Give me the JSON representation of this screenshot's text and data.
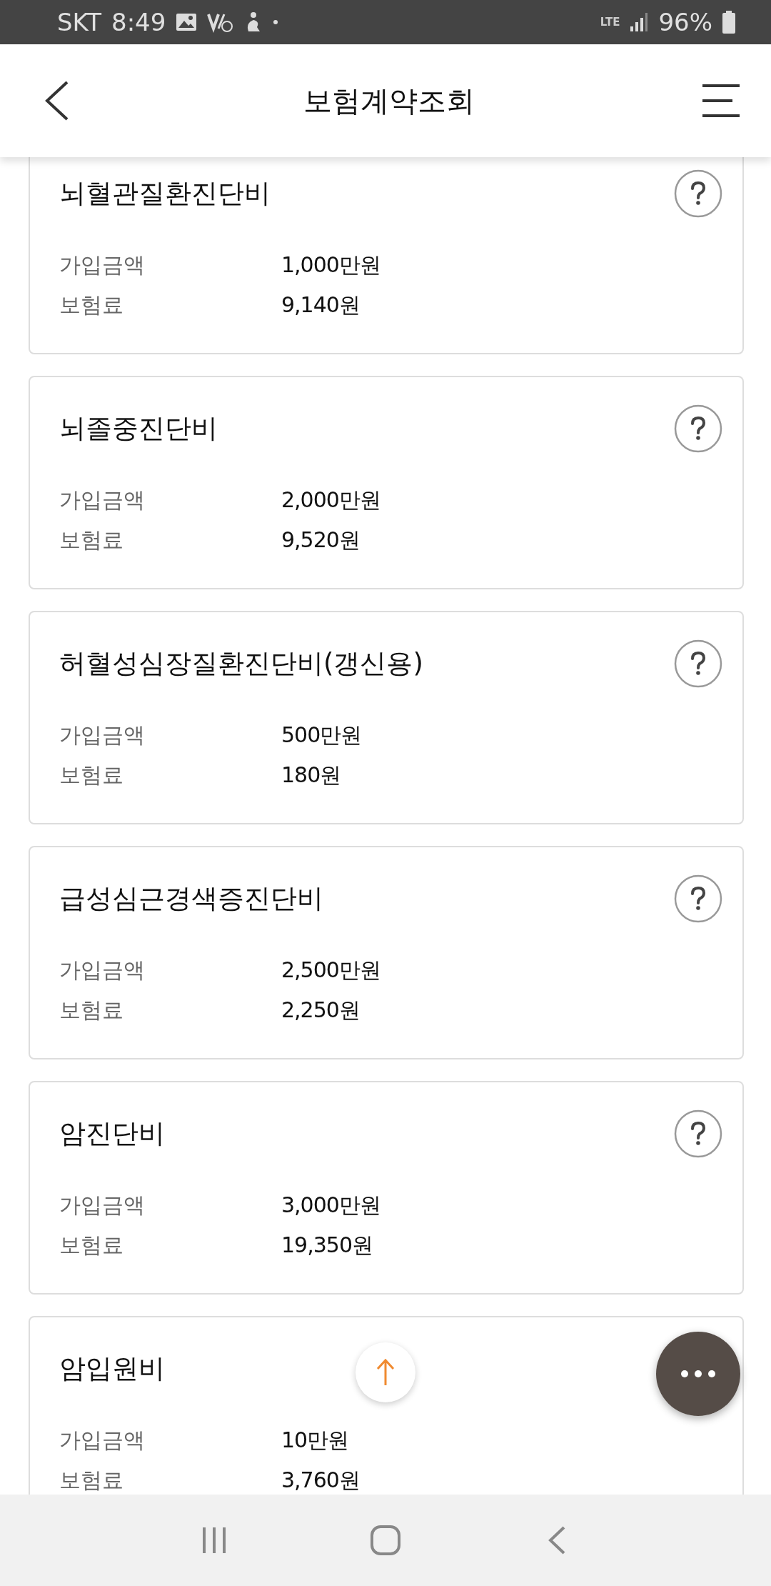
{
  "status_bar": {
    "carrier": "SKT",
    "time": "8:49",
    "network": "LTE",
    "battery": "96%"
  },
  "header": {
    "title": "보험계약조회"
  },
  "coverages": [
    {
      "name": "뇌혈관질환진단비",
      "help": true,
      "rows": [
        {
          "label": "가입금액",
          "value": "1,000만원"
        },
        {
          "label": "보험료",
          "value": "9,140원"
        }
      ]
    },
    {
      "name": "뇌졸중진단비",
      "help": true,
      "rows": [
        {
          "label": "가입금액",
          "value": "2,000만원"
        },
        {
          "label": "보험료",
          "value": "9,520원"
        }
      ]
    },
    {
      "name": "허혈성심장질환진단비(갱신용)",
      "help": true,
      "rows": [
        {
          "label": "가입금액",
          "value": "500만원"
        },
        {
          "label": "보험료",
          "value": "180원"
        }
      ]
    },
    {
      "name": "급성심근경색증진단비",
      "help": true,
      "rows": [
        {
          "label": "가입금액",
          "value": "2,500만원"
        },
        {
          "label": "보험료",
          "value": "2,250원"
        }
      ]
    },
    {
      "name": "암진단비",
      "help": true,
      "rows": [
        {
          "label": "가입금액",
          "value": "3,000만원"
        },
        {
          "label": "보험료",
          "value": "19,350원"
        }
      ]
    },
    {
      "name": "암입원비",
      "help": false,
      "rows": [
        {
          "label": "가입금액",
          "value": "10만원"
        },
        {
          "label": "보험료",
          "value": "3,760원"
        }
      ]
    }
  ]
}
